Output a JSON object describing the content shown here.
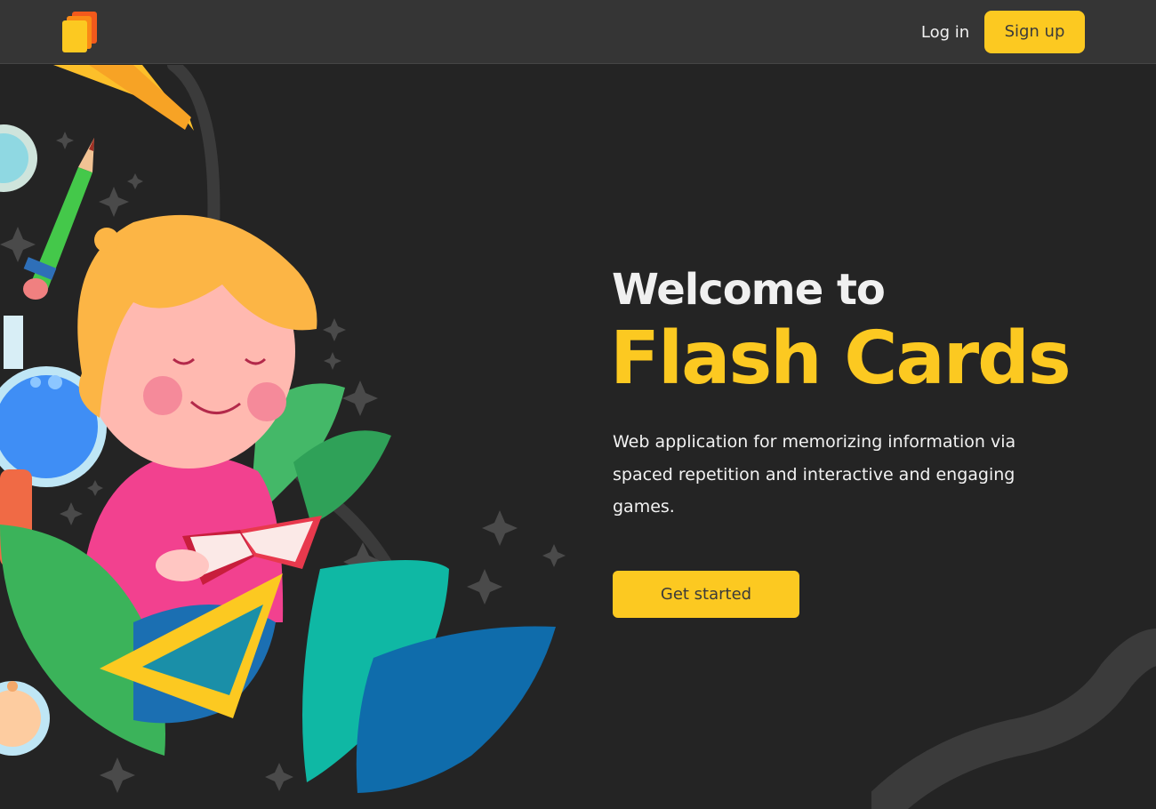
{
  "nav": {
    "logo_icon": "stacked-cards-icon",
    "login_label": "Log in",
    "signup_label": "Sign up"
  },
  "hero": {
    "welcome": "Welcome to",
    "title": "Flash Cards",
    "description": "Web application for memorizing information via spaced repetition and interactive and engaging games.",
    "cta_label": "Get started",
    "illustration": "child-reading-book-with-school-supplies"
  },
  "colors": {
    "background": "#242424",
    "navbar": "#353535",
    "accent": "#fcc921",
    "text": "#f2f2f2",
    "button_text": "#3a3a3a"
  }
}
